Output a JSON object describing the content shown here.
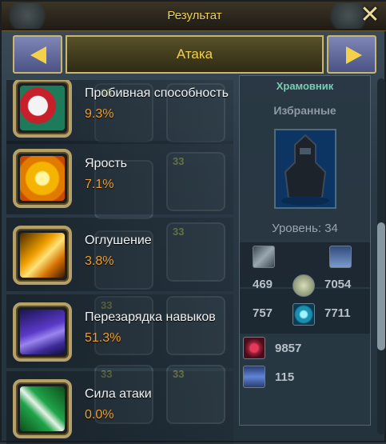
{
  "window": {
    "title": "Результат",
    "close_glyph": "✕"
  },
  "category": {
    "label": "Атака",
    "left_icon": "arrow-left-icon",
    "right_icon": "arrow-right-icon"
  },
  "stats": [
    {
      "name": "Пробивная способность",
      "value": "9.3%",
      "icon": "penetration-icon"
    },
    {
      "name": "Ярость",
      "value": "7.1%",
      "icon": "fury-icon"
    },
    {
      "name": "Оглушение",
      "value": "3.8%",
      "icon": "stun-icon"
    },
    {
      "name": "Перезарядка навыков",
      "value": "51.3%",
      "icon": "cooldown-icon"
    },
    {
      "name": "Сила атаки",
      "value": "0.0%",
      "icon": "attack-power-icon"
    }
  ],
  "ghost_numbers": [
    "33",
    "33",
    "33",
    "33",
    "33",
    "33"
  ],
  "character": {
    "class_name": "Храмовник",
    "rank": "Избранные",
    "level_text": "Уровень: 34",
    "stats": {
      "attack": "469",
      "hp_figure": "7054",
      "defense": "757",
      "magic": "7711",
      "health": "9857",
      "energy": "115"
    }
  },
  "colors": {
    "accent_gold": "#f3d24a",
    "value_orange": "#f0a02e",
    "class_green": "#76cfae"
  }
}
